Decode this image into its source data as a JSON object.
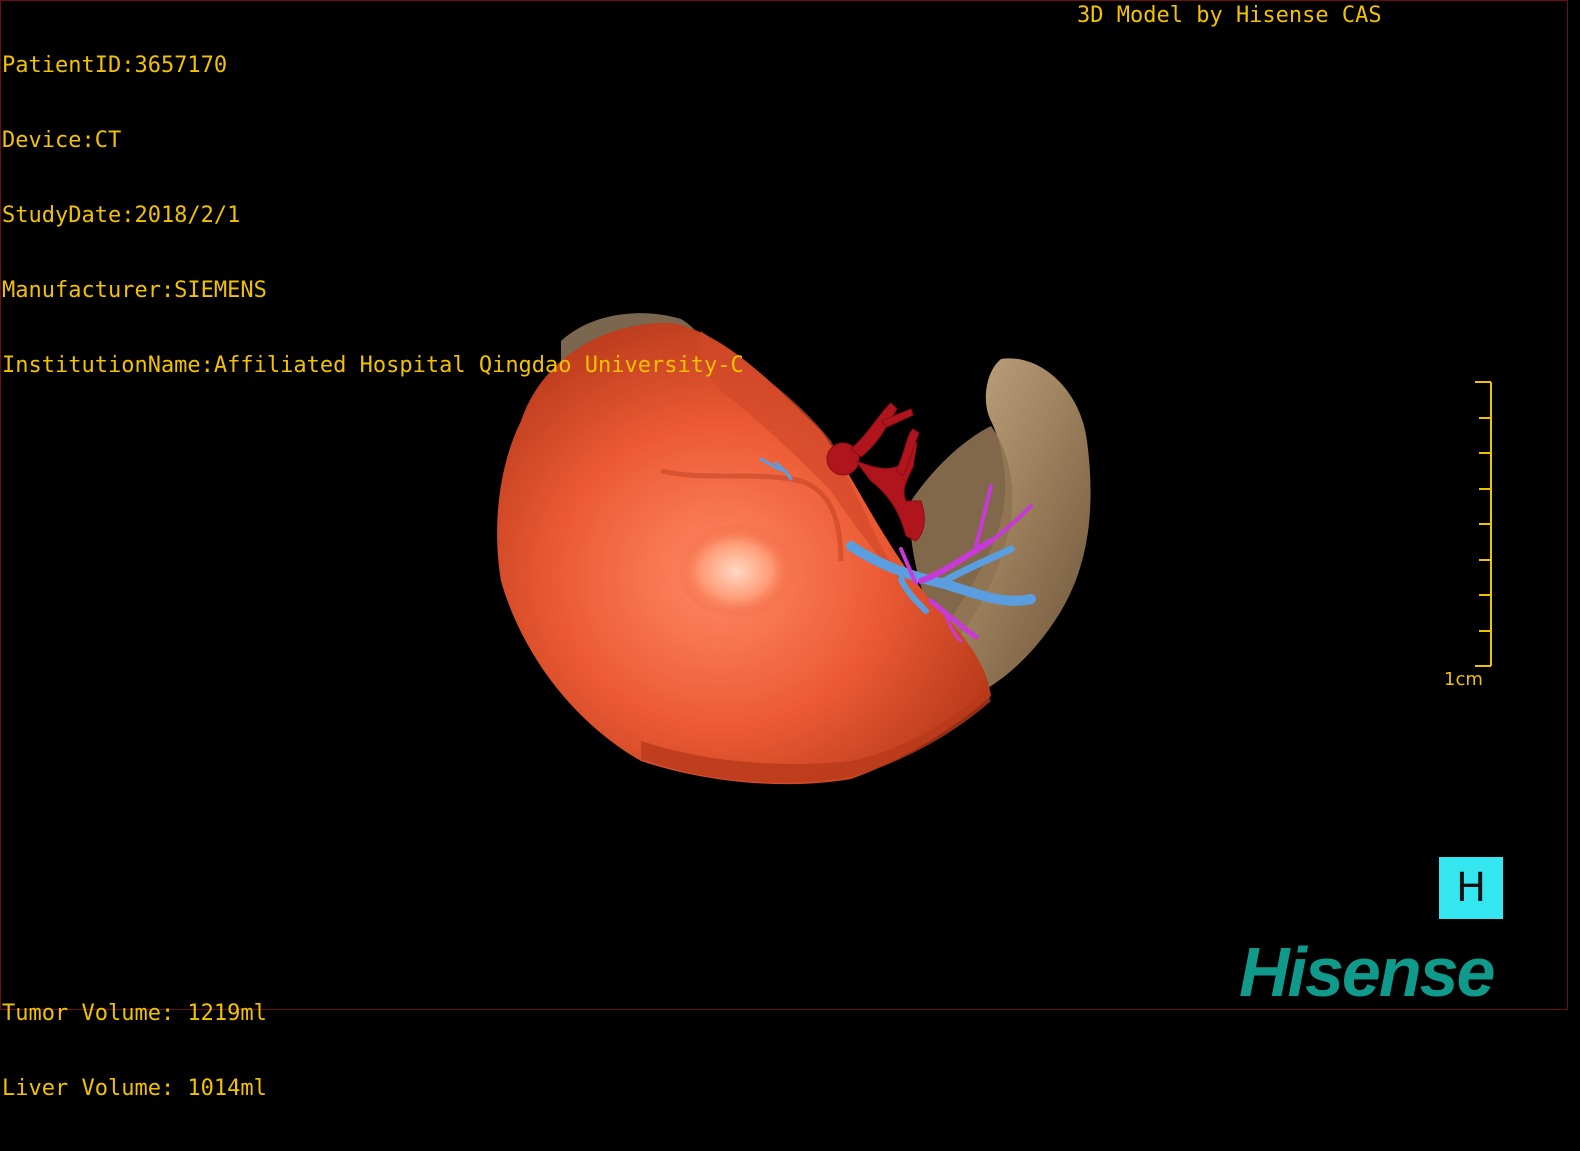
{
  "dicom_info": {
    "patient_id": "PatientID:3657170",
    "device": "Device:CT",
    "study_date": "StudyDate:2018/2/1",
    "manufacturer": "Manufacturer:SIEMENS",
    "institution": "InstitutionName:Affiliated Hospital Qingdao University-C"
  },
  "credit": "3D Model by Hisense CAS",
  "volumes": {
    "tumor": "Tumor Volume: 1219ml",
    "liver": "Liver Volume: 1014ml"
  },
  "scale": {
    "label": "1cm"
  },
  "orientation_marker": "H",
  "brand": "Hisense",
  "colors": {
    "overlay_text": "#f2c200",
    "tumor": "#ec5a34",
    "liver": "#a08462",
    "artery": "#b0141c",
    "portal_vein": "#5a9ee0",
    "hepatic_vein": "#c63ad8",
    "orientation_box": "#33e6f0",
    "brand": "#0f9a8c"
  }
}
